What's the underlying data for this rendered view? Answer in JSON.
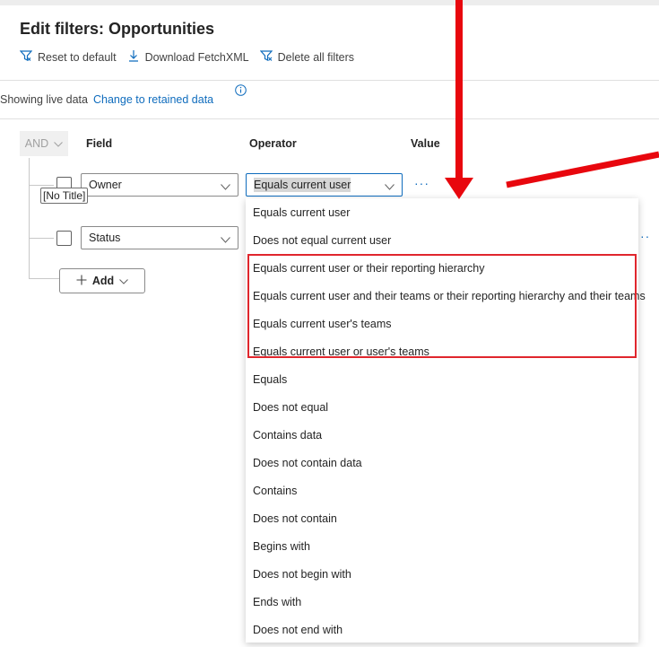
{
  "header": {
    "title": "Edit filters: Opportunities"
  },
  "toolbar": {
    "reset_label": "Reset to default",
    "download_label": "Download FetchXML",
    "delete_label": "Delete all filters"
  },
  "data_mode": {
    "text": "Showing live data",
    "link": "Change to retained data"
  },
  "filter_grid": {
    "logic": "AND",
    "headers": {
      "field": "Field",
      "operator": "Operator",
      "value": "Value"
    },
    "rows": [
      {
        "field": "Owner",
        "operator": "Equals current user"
      },
      {
        "field": "Status"
      }
    ],
    "tooltip": "[No Title]",
    "add_label": "Add"
  },
  "operator_dropdown": {
    "options": [
      "Equals current user",
      "Does not equal current user",
      "Equals current user or their reporting hierarchy",
      "Equals current user and their teams or their reporting hierarchy and their teams",
      "Equals current user's teams",
      "Equals current user or user's teams",
      "Equals",
      "Does not equal",
      "Contains data",
      "Does not contain data",
      "Contains",
      "Does not contain",
      "Begins with",
      "Does not begin with",
      "Ends with",
      "Does not end with"
    ]
  },
  "annotations": {
    "color": "#e8070e"
  },
  "colors": {
    "accent": "#0f6cbd",
    "highlight": "#e0262d"
  }
}
